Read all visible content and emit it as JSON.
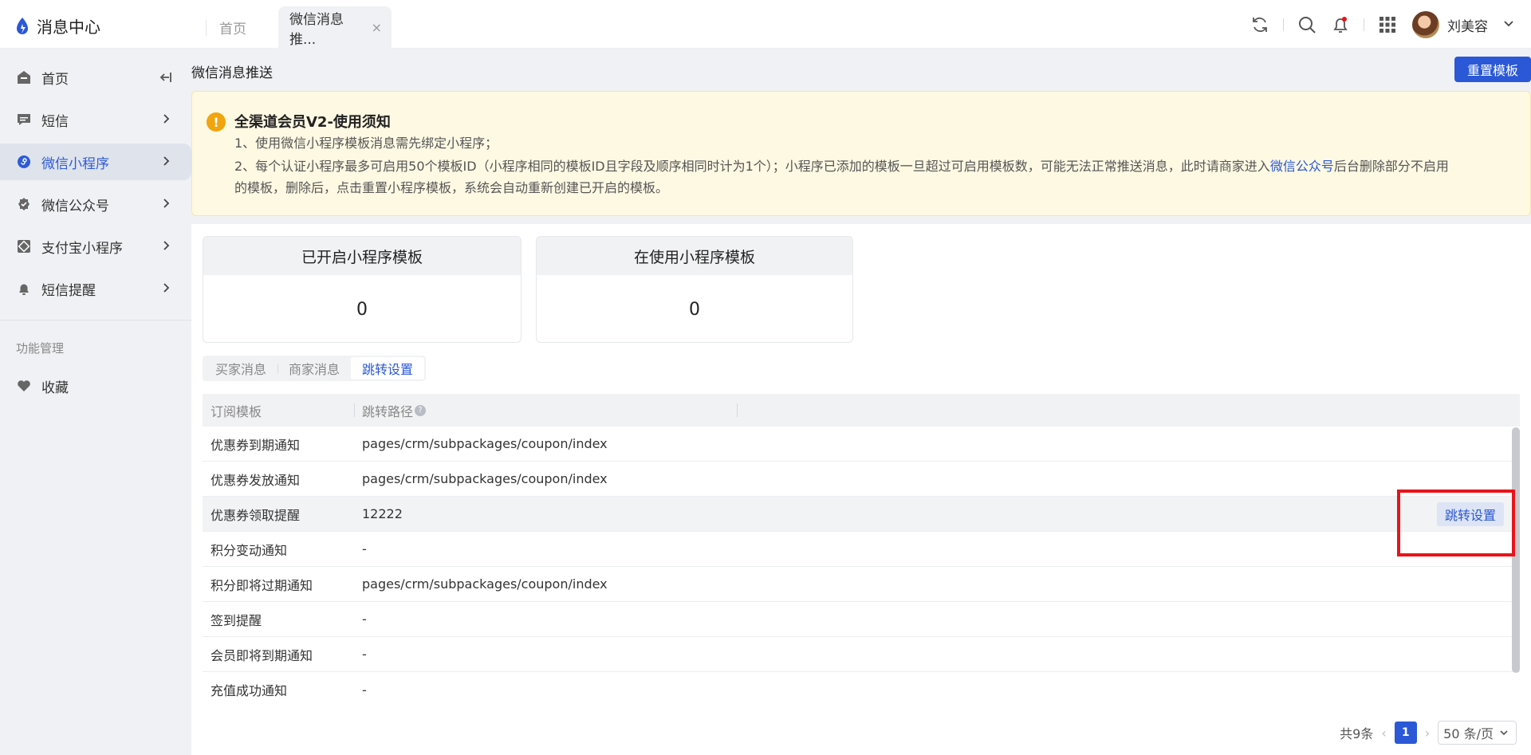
{
  "app": {
    "title": "消息中心"
  },
  "tabs": [
    {
      "label": "首页"
    },
    {
      "label": "微信消息推..."
    }
  ],
  "user": {
    "name": "刘美容"
  },
  "sidebar": {
    "items": [
      {
        "label": "首页",
        "icon": "home-icon"
      },
      {
        "label": "短信",
        "icon": "message-icon"
      },
      {
        "label": "微信小程序",
        "icon": "mini-program-icon"
      },
      {
        "label": "微信公众号",
        "icon": "badge-icon"
      },
      {
        "label": "支付宝小程序",
        "icon": "alipay-icon"
      },
      {
        "label": "短信提醒",
        "icon": "bell-icon"
      }
    ],
    "section_title": "功能管理",
    "favorites_label": "收藏"
  },
  "page": {
    "title": "微信消息推送",
    "reset_button": "重置模板"
  },
  "notice": {
    "title": "全渠道会员V2-使用须知",
    "line1": "1、使用微信小程序模板消息需先绑定小程序；",
    "line2_part1": "2、每个认证小程序最多可启用50个模板ID（小程序相同的模板ID且字段及顺序相同时计为1个）；小程序已添加的模板一旦超过可启用模板数，可能无法正常推送消息，此时请商家进入",
    "line2_link": "微信公众号",
    "line2_part2": "后台删除部分不启用",
    "line3": "的模板，删除后，点击重置小程序模板，系统会自动重新创建已开启的模板。"
  },
  "stats": [
    {
      "label": "已开启小程序模板",
      "value": "0"
    },
    {
      "label": "在使用小程序模板",
      "value": "0"
    }
  ],
  "segments": [
    {
      "label": "买家消息"
    },
    {
      "label": "商家消息"
    },
    {
      "label": "跳转设置"
    }
  ],
  "table": {
    "headers": [
      "订阅模板",
      "跳转路径"
    ],
    "rows": [
      {
        "template": "优惠券到期通知",
        "path": "pages/crm/subpackages/coupon/index"
      },
      {
        "template": "优惠券发放通知",
        "path": "pages/crm/subpackages/coupon/index"
      },
      {
        "template": "优惠券领取提醒",
        "path": "12222",
        "action": "跳转设置"
      },
      {
        "template": "积分变动通知",
        "path": "-"
      },
      {
        "template": "积分即将过期通知",
        "path": "pages/crm/subpackages/coupon/index"
      },
      {
        "template": "签到提醒",
        "path": "-"
      },
      {
        "template": "会员即将到期通知",
        "path": "-"
      },
      {
        "template": "充值成功通知",
        "path": "-"
      }
    ]
  },
  "pagination": {
    "total": "共9条",
    "current": "1",
    "page_size": "50 条/页"
  },
  "colors": {
    "accent": "#2a58d6",
    "highlight": "#e8141a",
    "notice_bg": "#fef9e3"
  }
}
